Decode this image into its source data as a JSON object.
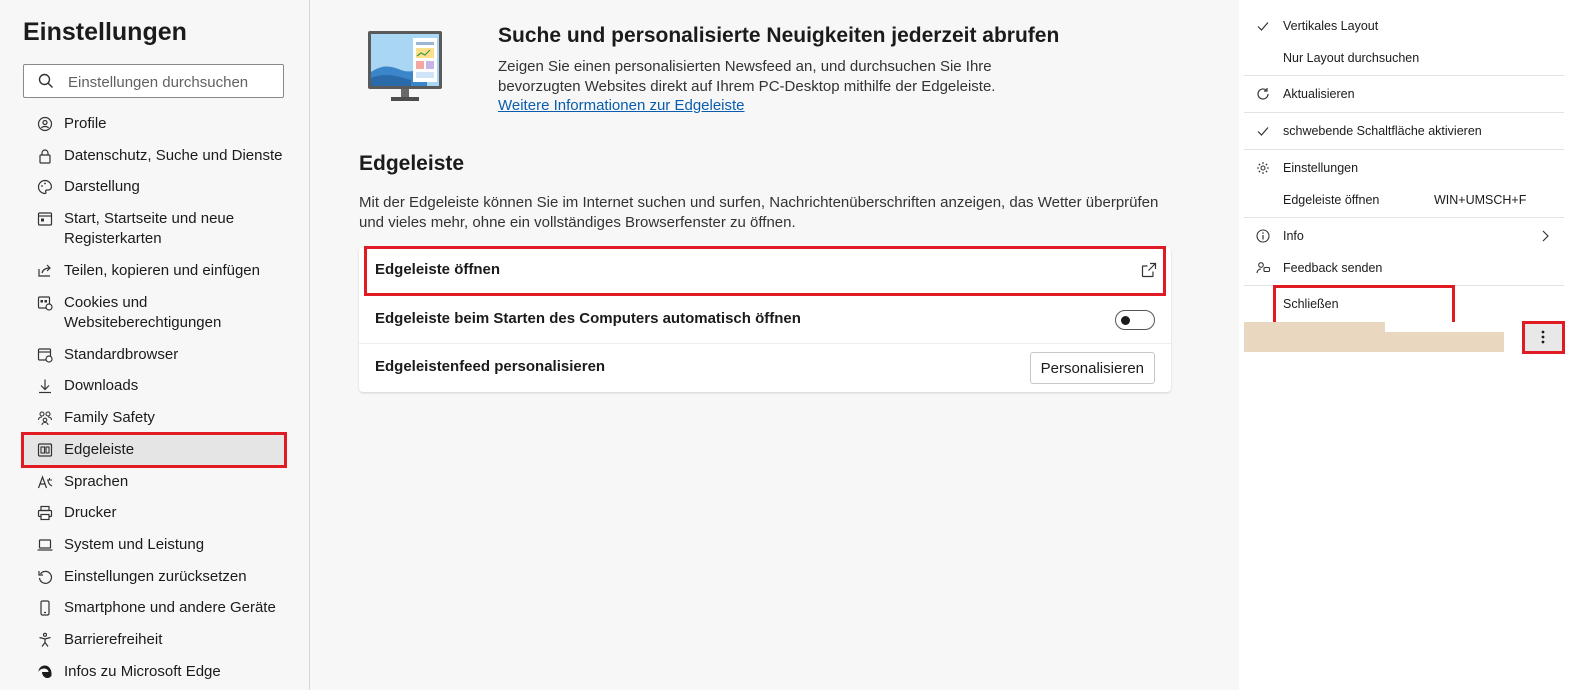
{
  "sidebar": {
    "title": "Einstellungen",
    "search_placeholder": "Einstellungen durchsuchen",
    "items": [
      {
        "label": "Profile",
        "icon": "profile-icon"
      },
      {
        "label": "Datenschutz, Suche und Dienste",
        "icon": "lock-icon"
      },
      {
        "label": "Darstellung",
        "icon": "palette-icon"
      },
      {
        "label": "Start, Startseite und neue Registerkarten",
        "icon": "home-icon"
      },
      {
        "label": "Teilen, kopieren und einfügen",
        "icon": "share-icon"
      },
      {
        "label": "Cookies und Websiteberechtigungen",
        "icon": "cookie-icon"
      },
      {
        "label": "Standardbrowser",
        "icon": "browser-icon"
      },
      {
        "label": "Downloads",
        "icon": "download-icon"
      },
      {
        "label": "Family Safety",
        "icon": "family-icon"
      },
      {
        "label": "Edgeleiste",
        "icon": "sidebar-icon",
        "active": true
      },
      {
        "label": "Sprachen",
        "icon": "language-icon"
      },
      {
        "label": "Drucker",
        "icon": "printer-icon"
      },
      {
        "label": "System und Leistung",
        "icon": "laptop-icon"
      },
      {
        "label": "Einstellungen zurücksetzen",
        "icon": "reset-icon"
      },
      {
        "label": "Smartphone und andere Geräte",
        "icon": "phone-icon"
      },
      {
        "label": "Barrierefreiheit",
        "icon": "accessibility-icon"
      },
      {
        "label": "Infos zu Microsoft Edge",
        "icon": "edge-icon"
      }
    ]
  },
  "main": {
    "promo": {
      "title": "Suche und personalisierte Neuigkeiten jederzeit abrufen",
      "description": "Zeigen Sie einen personalisierten Newsfeed an, und durchsuchen Sie Ihre bevorzugten Websites direkt auf Ihrem PC-Desktop mithilfe der Edgeleiste.",
      "link": "Weitere Informationen zur Edgeleiste"
    },
    "section_title": "Edgeleiste",
    "section_description": "Mit der Edgeleiste können Sie im Internet suchen und surfen, Nachrichtenüberschriften anzeigen, das Wetter überprüfen und vieles mehr, ohne ein vollständiges Browserfenster zu öffnen.",
    "rows": {
      "open": "Edgeleiste öffnen",
      "autostart": "Edgeleiste beim Starten des Computers automatisch öffnen",
      "autostart_on": false,
      "personalize": "Edgeleistenfeed personalisieren",
      "personalize_button": "Personalisieren"
    }
  },
  "menu": {
    "vertical_layout": "Vertikales Layout",
    "layout_search": "Nur Layout durchsuchen",
    "refresh": "Aktualisieren",
    "floating_button": "schwebende Schaltfläche aktivieren",
    "settings": "Einstellungen",
    "open_bar": "Edgeleiste öffnen",
    "open_bar_shortcut": "WIN+UMSCH+F",
    "info": "Info",
    "feedback": "Feedback senden",
    "close": "Schließen"
  },
  "colors": {
    "highlight": "#e01b24",
    "link": "#0a5cad",
    "accent_strip": "#e9d7c0"
  }
}
